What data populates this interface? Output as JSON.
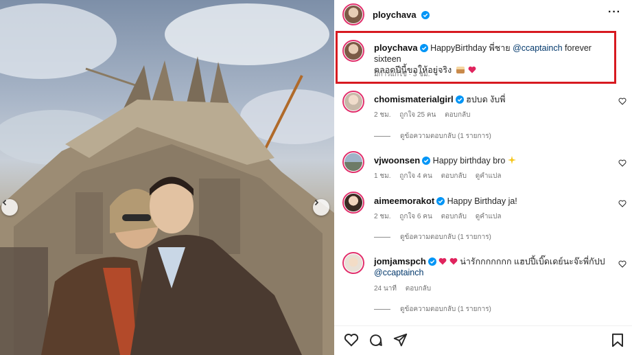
{
  "post": {
    "username": "ploychava"
  },
  "caption": {
    "username": "ploychava",
    "text_a": "HappyBirthday พี่ชาย",
    "mention": "@ccaptainch",
    "text_b": "forever sixteen",
    "text_c": "ตลอดปีนี้ขอให้อยู่จริง",
    "meta": "มีการแก้ไข · 3 ชม."
  },
  "comments": [
    {
      "username": "chomismaterialgirl",
      "verified": true,
      "text": "ฮปบด งับพี่",
      "time": "2 ชม.",
      "likes": "ถูกใจ 25 คน",
      "reply": "ตอบกลับ",
      "translate": "",
      "view_replies": "ดูข้อความตอบกลับ (1 รายการ)"
    },
    {
      "username": "vjwoonsen",
      "verified": true,
      "text": "Happy birthday bro",
      "time": "1 ชม.",
      "likes": "ถูกใจ 4 คน",
      "reply": "ตอบกลับ",
      "translate": "ดูคำแปล",
      "view_replies": ""
    },
    {
      "username": "aimeemorakot",
      "verified": true,
      "text": "Happy Birthday ja!",
      "time": "2 ชม.",
      "likes": "ถูกใจ 6 คน",
      "reply": "ตอบกลับ",
      "translate": "ดูคำแปล",
      "view_replies": "ดูข้อความตอบกลับ (1 รายการ)"
    },
    {
      "username": "jomjamspch",
      "verified": true,
      "text": "น่ารักกกกกกก แฮปปี้เบิ๊ดเดย์นะจ๊ะพี่กัปป",
      "mention": "@ccaptainch",
      "time": "24 นาที",
      "likes": "",
      "reply": "ตอบกลับ",
      "translate": "",
      "view_replies": "ดูข้อความตอบกลับ (1 รายการ)"
    }
  ],
  "colors": {
    "highlight_border": "#d71920",
    "verified_blue": "#0095f6",
    "heart_red": "#e0245e",
    "story_ring": "#e1306c"
  },
  "icons": [
    "verified-badge-icon",
    "more-options-icon",
    "heart-icon",
    "comment-icon",
    "share-icon",
    "bookmark-icon",
    "chevron-left-icon",
    "chevron-right-icon",
    "sparkles-icon",
    "cake-icon"
  ]
}
